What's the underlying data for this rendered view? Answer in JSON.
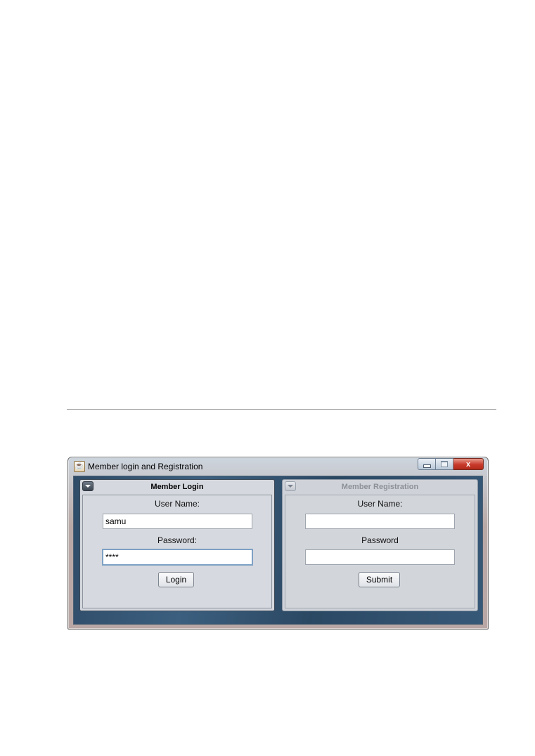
{
  "window": {
    "title": "Member login and Registration",
    "controls": {
      "close_glyph": "x"
    }
  },
  "login_panel": {
    "title": "Member Login",
    "username_label": "User Name:",
    "username_value": "samu",
    "password_label": "Password:",
    "password_value": "****",
    "button_label": "Login"
  },
  "registration_panel": {
    "title": "Member Registration",
    "username_label": "User Name:",
    "username_value": "",
    "password_label": "Password",
    "password_value": "",
    "button_label": "Submit"
  },
  "icons": {
    "app": "java-coffee-icon",
    "minimize": "minimize-icon",
    "maximize": "maximize-icon",
    "close": "close-icon",
    "collapse": "chevron-down-icon"
  },
  "colors": {
    "close_button": "#c8392a",
    "desktop_background": "#2f4c68",
    "focus_border": "#7ea1c4"
  }
}
